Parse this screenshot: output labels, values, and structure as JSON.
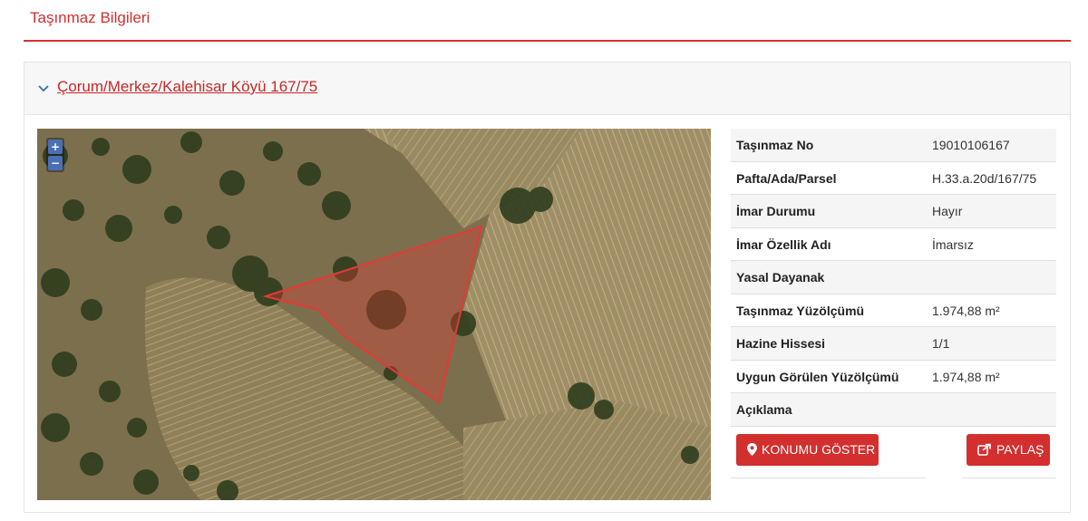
{
  "header": {
    "title": "Taşınmaz Bilgileri"
  },
  "panel": {
    "title": "Çorum/Merkez/Kalehisar Köyü 167/75"
  },
  "map": {
    "zoom_in": "+",
    "zoom_out": "−",
    "parcel_color": "#e53935"
  },
  "info": {
    "rows": [
      {
        "label": "Taşınmaz No",
        "value": "19010106167"
      },
      {
        "label": "Pafta/Ada/Parsel",
        "value": "H.33.a.20d/167/75"
      },
      {
        "label": "İmar Durumu",
        "value": "Hayır"
      },
      {
        "label": "İmar Özellik Adı",
        "value": "İmarsız"
      },
      {
        "label": "Yasal Dayanak",
        "value": ""
      },
      {
        "label": "Taşınmaz Yüzölçümü",
        "value": "1.974,88 m²"
      },
      {
        "label": "Hazine Hissesi",
        "value": "1/1"
      },
      {
        "label": "Uygun Görülen Yüzölçümü",
        "value": "1.974,88 m²"
      },
      {
        "label": "Açıklama",
        "value": ""
      }
    ]
  },
  "buttons": {
    "locate": "KONUMU GÖSTER",
    "share": "PAYLAŞ"
  },
  "colors": {
    "accent": "#d32f2f"
  }
}
